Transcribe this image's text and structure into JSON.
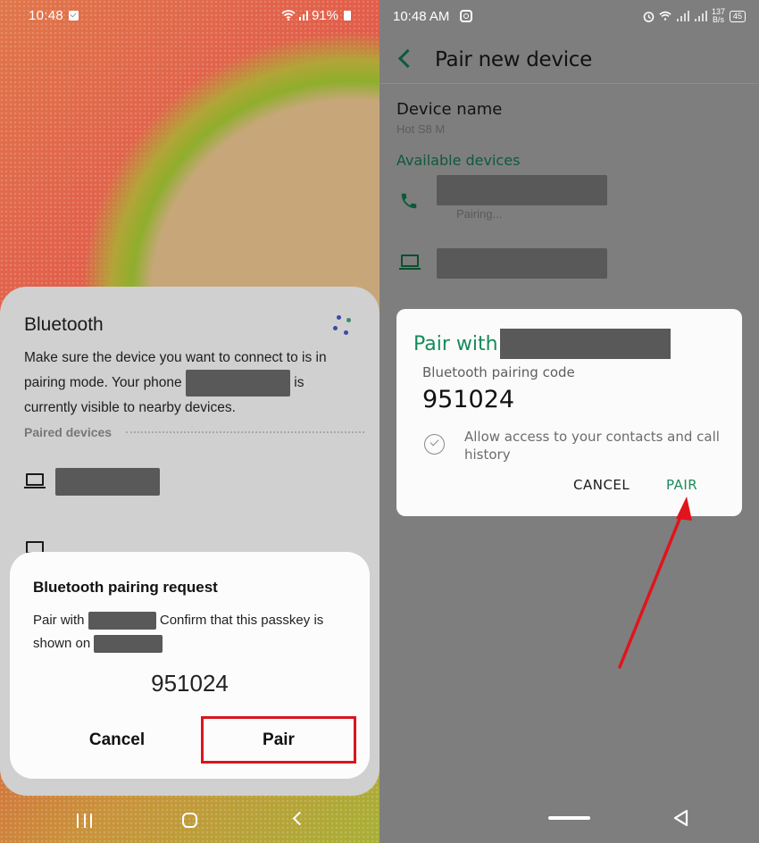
{
  "left_phone": {
    "status_bar": {
      "time": "10:48",
      "signal_text": ".ıll",
      "battery": "91%"
    },
    "bluetooth_sheet": {
      "title": "Bluetooth",
      "desc_part1": "Make sure the device you want to connect to is in pairing mode. Your phone",
      "desc_part2": "is currently visible to nearby devices.",
      "paired_devices_header": "Paired devices",
      "paired_devices": [
        {
          "icon": "laptop-icon",
          "name_redacted": true
        },
        {
          "icon": "laptop-icon",
          "name_redacted": true
        }
      ]
    },
    "pairing_request": {
      "title": "Bluetooth pairing request",
      "body_part1": "Pair with",
      "body_part2": "Confirm that this passkey is shown on",
      "passkey": "951024",
      "cancel_label": "Cancel",
      "pair_label": "Pair",
      "highlight_color": "#d9151f"
    },
    "nav_bar": [
      "recents-icon",
      "home-icon",
      "back-icon"
    ]
  },
  "right_phone": {
    "status_bar": {
      "time": "10:48 AM",
      "net_speed_value": "137",
      "net_speed_unit": "B/s",
      "battery": "45"
    },
    "app_bar": {
      "title": "Pair new device"
    },
    "device_name": {
      "label": "Device name",
      "value": "Hot S8 M"
    },
    "available_devices": {
      "header": "Available devices",
      "items": [
        {
          "icon": "phone-icon",
          "name_redacted": true,
          "status": "Pairing..."
        },
        {
          "icon": "laptop-icon",
          "name_redacted": true,
          "status": ""
        }
      ]
    },
    "pair_dialog": {
      "title": "Pair with",
      "code_label": "Bluetooth pairing code",
      "code": "951024",
      "checkbox_label": "Allow access to your contacts and call history",
      "cancel_label": "CANCEL",
      "pair_label": "PAIR",
      "accent_color": "#168a5b"
    },
    "annotation": {
      "type": "arrow",
      "color": "#e0141c",
      "points_to": "PAIR"
    },
    "nav_bar": [
      "home-pill-icon",
      "back-triangle-icon"
    ]
  }
}
